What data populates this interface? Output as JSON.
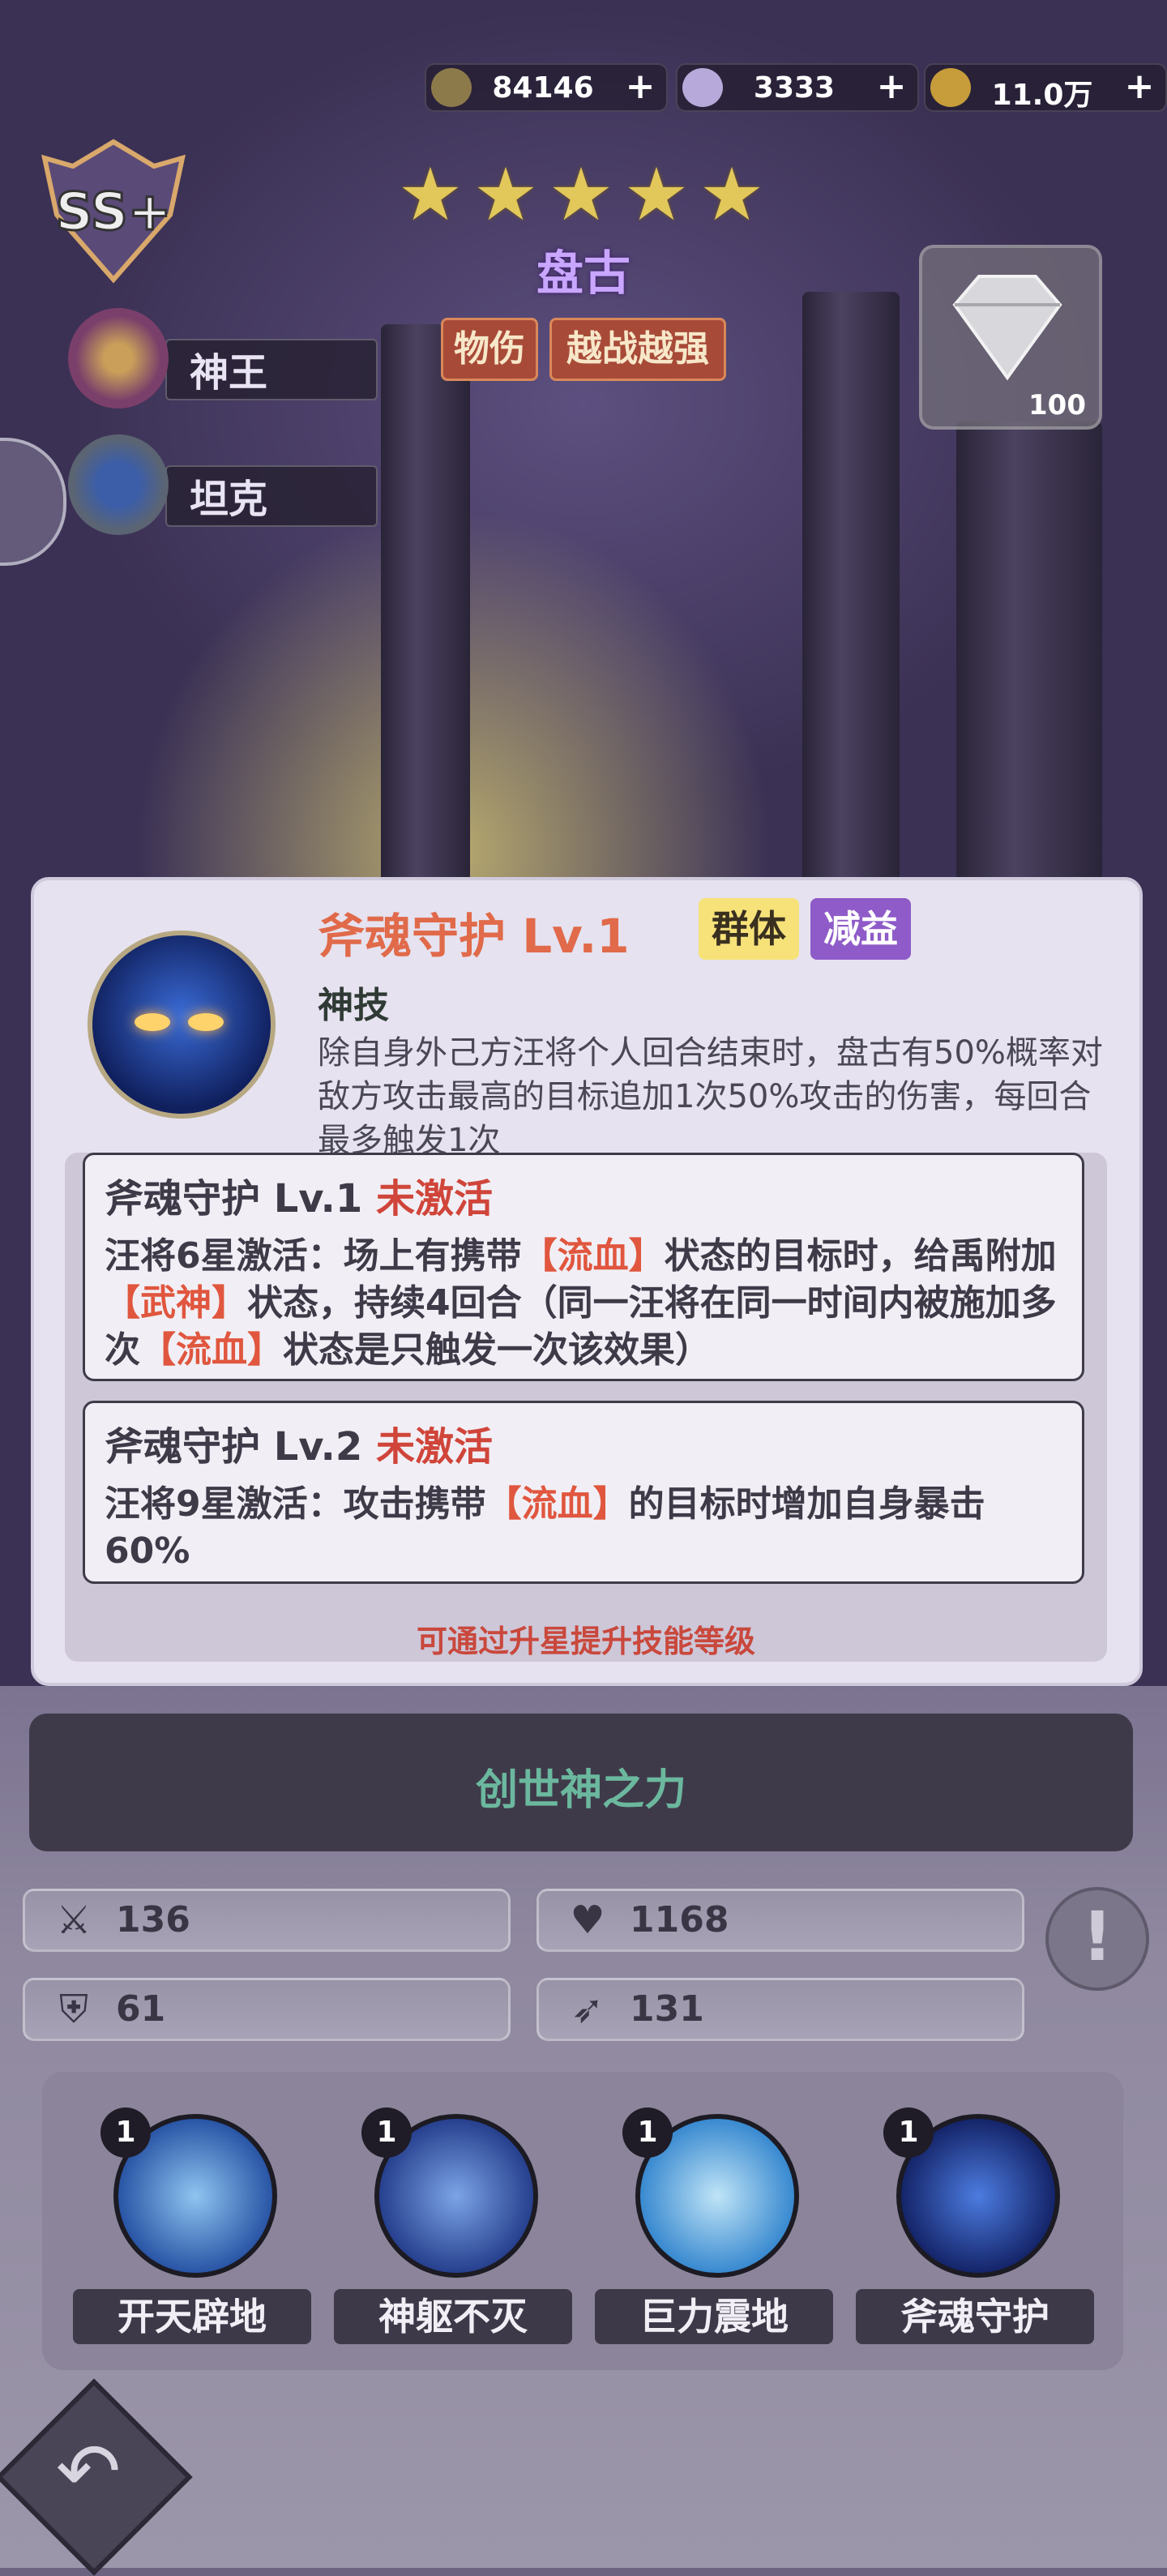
{
  "resources": [
    {
      "icon": "battle-power-icon",
      "value": "84146"
    },
    {
      "icon": "diamond-icon",
      "value": "3333"
    },
    {
      "icon": "gold-coin-icon",
      "value": "11.0万"
    }
  ],
  "rank_badge": "SS+",
  "hero": {
    "stars": 5,
    "name": "盘古",
    "tags": [
      "物伤",
      "越战越强"
    ],
    "roles": [
      {
        "icon": "god-king-emblem-icon",
        "label": "神王"
      },
      {
        "icon": "shield-emblem-icon",
        "label": "坦克"
      }
    ],
    "gem_slot_count": "100"
  },
  "popup": {
    "title": "斧魂守护  Lv.1",
    "pills": [
      "群体",
      "减益"
    ],
    "type": "神技",
    "description": "除自身外己方汪将个人回合结束时，盘古有50%概率对敌方攻击最高的目标追加1次50%攻击的伤害，每回合最多触发1次",
    "levels": [
      {
        "name": "斧魂守护  Lv.1",
        "status": "未激活",
        "p1": "汪将6星激活：场上有携带",
        "k1": "【流血】",
        "p2": "状态的目标时，给禹附加",
        "k2": "【武神】",
        "p3": "状态，持续4回合（同一汪将在同一时间内被施加多次",
        "k3": "【流血】",
        "p4": "状态是只触发一次该效果）"
      },
      {
        "name": "斧魂守护  Lv.2",
        "status": "未激活",
        "p1": "汪将9星激活：攻击携带",
        "k1": "【流血】",
        "p2": "的目标时增加自身暴击60%"
      }
    ],
    "footer": "可通过升星提升技能等级"
  },
  "main_button": "创世神之力",
  "stats": [
    {
      "icon": "sword-icon",
      "value": "136"
    },
    {
      "icon": "heart-icon",
      "value": "1168"
    },
    {
      "icon": "armor-icon",
      "value": "61"
    },
    {
      "icon": "boot-speed-icon",
      "value": "131"
    }
  ],
  "skills": [
    {
      "level": "1",
      "name": "开天辟地",
      "color": "#4b7fd0"
    },
    {
      "level": "1",
      "name": "神躯不灭",
      "color": "#3d66b8"
    },
    {
      "level": "1",
      "name": "巨力震地",
      "color": "#5aa0d8"
    },
    {
      "level": "1",
      "name": "斧魂守护",
      "color": "#2a4aa8"
    }
  ],
  "info_button": "!",
  "colors": {
    "accent_red": "#e06a4a",
    "status_red": "#d0453a",
    "button_green": "#6bb89e"
  }
}
